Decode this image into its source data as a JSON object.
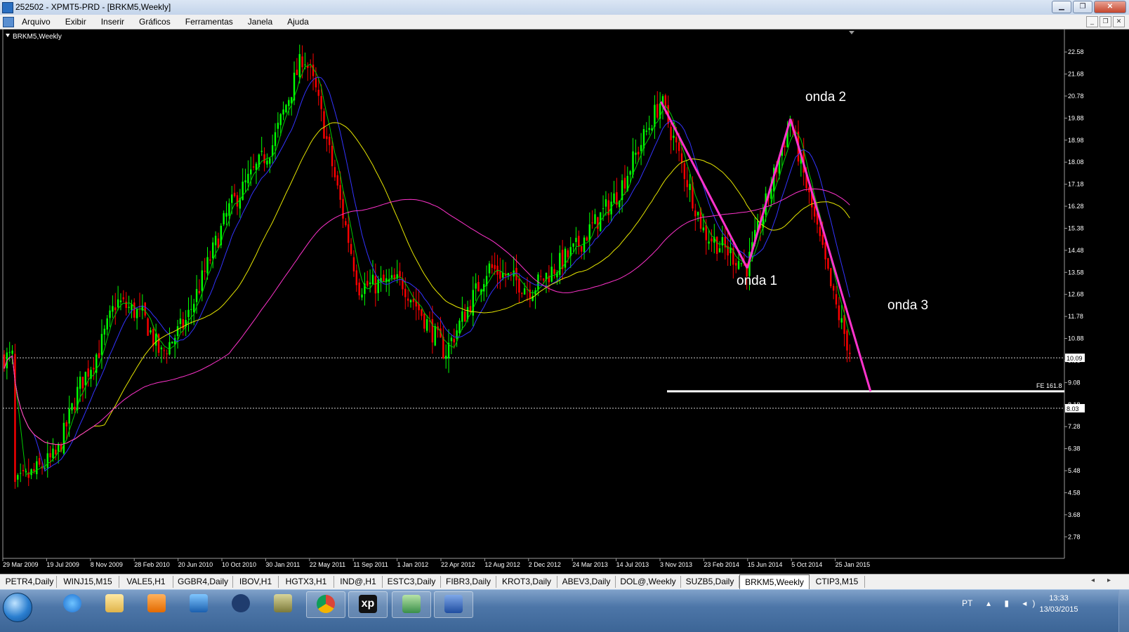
{
  "window": {
    "title": "252502 - XPMT5-PRD - [BRKM5,Weekly]",
    "min": "▁",
    "max": "❐",
    "close": "✕"
  },
  "menu": [
    "Arquivo",
    "Exibir",
    "Inserir",
    "Gráficos",
    "Ferramentas",
    "Janela",
    "Ajuda"
  ],
  "mdi": [
    "_",
    "❐",
    "✕"
  ],
  "chart": {
    "symbol_label": "BRKM5,Weekly",
    "background": "#000000",
    "up_color": "#00ff00",
    "down_color": "#ff0000",
    "price_axis": [
      "22.58",
      "21.68",
      "20.78",
      "19.88",
      "18.98",
      "18.08",
      "17.18",
      "16.28",
      "15.38",
      "14.48",
      "13.58",
      "12.68",
      "11.78",
      "10.88",
      "9.98",
      "9.08",
      "8.18",
      "7.28",
      "6.38",
      "5.48",
      "4.58",
      "3.68",
      "2.78"
    ],
    "date_axis": [
      "29 Mar 2009",
      "19 Jul 2009",
      "8 Nov 2009",
      "28 Feb 2010",
      "20 Jun 2010",
      "10 Oct 2010",
      "30 Jan 2011",
      "22 May 2011",
      "11 Sep 2011",
      "1 Jan 2012",
      "22 Apr 2012",
      "12 Aug 2012",
      "2 Dec 2012",
      "24 Mar 2013",
      "14 Jul 2013",
      "3 Nov 2013",
      "23 Feb 2014",
      "15 Jun 2014",
      "5 Oct 2014",
      "25 Jan 2015"
    ],
    "hlines": [
      {
        "price": 10.09,
        "label": "10.09"
      },
      {
        "price": 8.03,
        "label": "8.03"
      }
    ],
    "fe_level": {
      "price": 8.72,
      "label": "FE 161.8"
    },
    "annotations": {
      "onda1": "onda 1",
      "onda2": "onda 2",
      "onda3": "onda 3"
    },
    "wave_color": "#ff33cc",
    "ma_colors": {
      "fast": "#00cc00",
      "mid": "#3333ff",
      "slow": "#e6e600",
      "long": "#ff33cc"
    }
  },
  "chart_data": {
    "type": "candlestick",
    "title": "BRKM5,Weekly",
    "series_close_approx": [
      {
        "date": "2009-03-29",
        "value": 4.8
      },
      {
        "date": "2009-07-19",
        "value": 6.1
      },
      {
        "date": "2009-09-15",
        "value": 8.9
      },
      {
        "date": "2009-11-08",
        "value": 10.5
      },
      {
        "date": "2009-12-20",
        "value": 12.4
      },
      {
        "date": "2010-02-28",
        "value": 11.8
      },
      {
        "date": "2010-04-15",
        "value": 10.2
      },
      {
        "date": "2010-06-20",
        "value": 11.6
      },
      {
        "date": "2010-10-10",
        "value": 16.2
      },
      {
        "date": "2011-01-30",
        "value": 18.8
      },
      {
        "date": "2011-04-20",
        "value": 22.5
      },
      {
        "date": "2011-05-22",
        "value": 21.0
      },
      {
        "date": "2011-09-11",
        "value": 13.0
      },
      {
        "date": "2012-01-01",
        "value": 13.2
      },
      {
        "date": "2012-04-22",
        "value": 10.3
      },
      {
        "date": "2012-08-12",
        "value": 13.8
      },
      {
        "date": "2012-12-02",
        "value": 12.9
      },
      {
        "date": "2013-03-24",
        "value": 14.5
      },
      {
        "date": "2013-07-14",
        "value": 16.8
      },
      {
        "date": "2013-11-03",
        "value": 20.6
      },
      {
        "date": "2014-02-23",
        "value": 15.2
      },
      {
        "date": "2014-06-15",
        "value": 13.8
      },
      {
        "date": "2014-10-05",
        "value": 19.8
      },
      {
        "date": "2015-01-25",
        "value": 12.5
      },
      {
        "date": "2015-03-13",
        "value": 10.1
      }
    ],
    "wave_points": [
      {
        "date": "2013-11-03",
        "value": 20.55
      },
      {
        "date": "2014-06-15",
        "value": 13.75
      },
      {
        "date": "2014-10-05",
        "value": 19.85
      },
      {
        "date": "2015-05-01",
        "value": 8.72
      }
    ],
    "ylim": [
      1.9,
      23.5
    ]
  },
  "tabs": [
    "PETR4,Daily",
    "WINJ15,M15",
    "VALE5,H1",
    "GGBR4,Daily",
    "IBOV,H1",
    "HGTX3,H1",
    "IND@,H1",
    "ESTC3,Daily",
    "FIBR3,Daily",
    "KROT3,Daily",
    "ABEV3,Daily",
    "DOL@,Weekly",
    "SUZB5,Daily",
    "BRKM5,Weekly",
    "CTIP3,M15"
  ],
  "active_tab": "BRKM5,Weekly",
  "tab_arrows": [
    "◂",
    "▸"
  ],
  "taskbar": {
    "apps": [
      "internet-explorer",
      "file-explorer",
      "media-player",
      "outlook",
      "hp",
      "terminal",
      "chrome",
      "xp",
      "metatrader",
      "word"
    ],
    "xp_label": "xp",
    "lang": "PT",
    "tray_icons": "▴ ▮ ◂)",
    "time": "13:33",
    "date": "13/03/2015"
  }
}
